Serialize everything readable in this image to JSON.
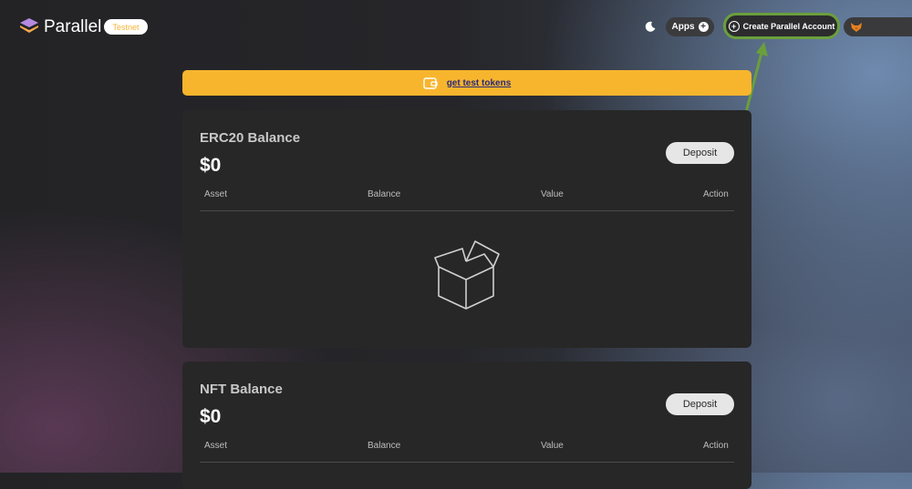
{
  "header": {
    "app_name": "Parallel",
    "network_badge": "Testnet",
    "apps_label": "Apps",
    "create_account_label": "Create Parallel Account",
    "icons": [
      "logo-layers-icon",
      "moon-icon",
      "plus-circle-icon",
      "fox-wallet-icon"
    ]
  },
  "banner": {
    "link_text": "get test tokens",
    "icon": "wallet-icon"
  },
  "erc20": {
    "title": "ERC20 Balance",
    "amount": "$0",
    "deposit_label": "Deposit",
    "columns": [
      "Asset",
      "Balance",
      "Value",
      "Action"
    ],
    "empty_icon": "empty-box-icon"
  },
  "nft": {
    "title": "NFT Balance",
    "amount": "$0",
    "deposit_label": "Deposit",
    "columns": [
      "Asset",
      "Balance",
      "Value",
      "Action"
    ]
  },
  "colors": {
    "accent_yellow": "#f7b52e",
    "highlight_green": "#6a9f3c",
    "card_bg": "#272727"
  }
}
